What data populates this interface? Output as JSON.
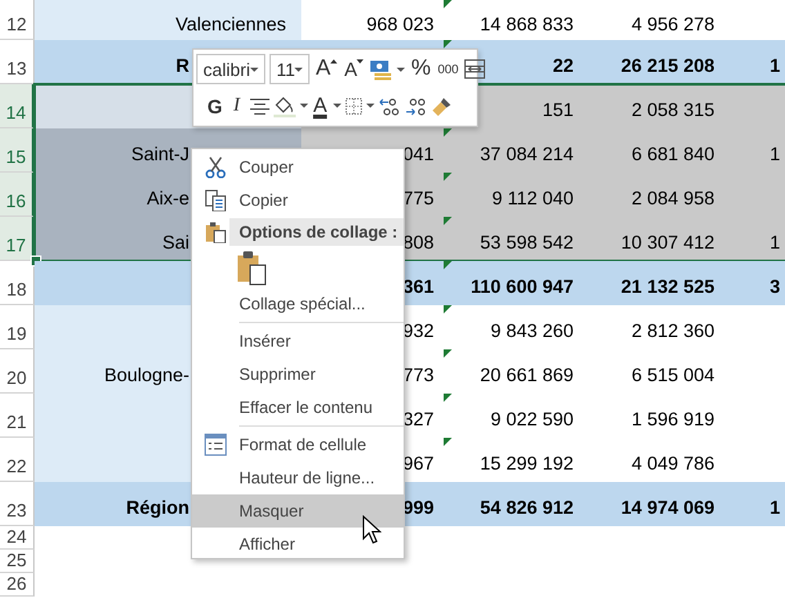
{
  "sheet": {
    "rows": [
      {
        "number": "12",
        "kind": "city",
        "selected": false,
        "flag": true,
        "cells": {
          "column_1": "Valenciennes",
          "column_2": "968 023",
          "column_3": "14 868 833",
          "column_4": "4 956 278"
        }
      },
      {
        "number": "13",
        "kind": "total",
        "selected": false,
        "flag": true,
        "cells": {
          "column_1": "R",
          "column_3": "22",
          "column_4": "26 215 208",
          "column_5": "1"
        }
      },
      {
        "number": "14",
        "kind": "heading",
        "selected": true,
        "flag": false,
        "cells": {
          "column_3": "151",
          "column_4": "2 058 315"
        }
      },
      {
        "number": "15",
        "kind": "city",
        "selected": true,
        "flag": true,
        "cells": {
          "column_1": "Saint-J",
          "column_2": "041",
          "column_3": "37 084 214",
          "column_4": "6 681 840",
          "column_5": "1"
        }
      },
      {
        "number": "16",
        "kind": "city",
        "selected": true,
        "flag": true,
        "cells": {
          "column_1": "Aix-e",
          "column_2": "775",
          "column_3": "9 112 040",
          "column_4": "2 084 958"
        }
      },
      {
        "number": "17",
        "kind": "city",
        "selected": true,
        "flag": true,
        "cells": {
          "column_1": "Sai",
          "column_2": "808",
          "column_3": "53 598 542",
          "column_4": "10 307 412",
          "column_5": "1"
        }
      },
      {
        "number": "18",
        "kind": "total",
        "selected": false,
        "flag": true,
        "cells": {
          "column_2": "361",
          "column_3": "110 600 947",
          "column_4": "21 132 525",
          "column_5": "3"
        }
      },
      {
        "number": "19",
        "kind": "city",
        "selected": false,
        "flag": true,
        "cells": {
          "column_2": "932",
          "column_3": "9 843 260",
          "column_4": "2 812 360"
        }
      },
      {
        "number": "20",
        "kind": "city",
        "selected": false,
        "flag": true,
        "cells": {
          "column_1": "Boulogne-",
          "column_2": "773",
          "column_3": "20 661 869",
          "column_4": "6 515 004"
        }
      },
      {
        "number": "21",
        "kind": "city",
        "selected": false,
        "flag": true,
        "cells": {
          "column_2": "327",
          "column_3": "9 022 590",
          "column_4": "1 596 919"
        }
      },
      {
        "number": "22",
        "kind": "city",
        "selected": false,
        "flag": true,
        "cells": {
          "column_2": "967",
          "column_3": "15 299 192",
          "column_4": "4 049 786"
        }
      },
      {
        "number": "23",
        "kind": "total",
        "selected": false,
        "flag": false,
        "cells": {
          "column_1": "Région",
          "column_2": "999",
          "column_3": "54 826 912",
          "column_4": "14 974 069",
          "column_5": "1"
        }
      },
      {
        "number": "24",
        "kind": "blank",
        "selected": false,
        "flag": false,
        "cells": {}
      },
      {
        "number": "25",
        "kind": "blank",
        "selected": false,
        "flag": false,
        "cells": {}
      },
      {
        "number": "26",
        "kind": "blank",
        "selected": false,
        "flag": false,
        "cells": {}
      }
    ]
  },
  "mini_toolbar": {
    "font": "calibri",
    "size": "11",
    "grow": "A",
    "shrink": "A",
    "percent": "%",
    "thousands": "000",
    "bold": "G",
    "italic": "I",
    "font_color": "A"
  },
  "context_menu": {
    "items": [
      {
        "kind": "item",
        "label": "Couper",
        "selected": false
      },
      {
        "kind": "item",
        "label": "Copier",
        "selected": false
      },
      {
        "kind": "header",
        "label": "Options de collage :"
      },
      {
        "kind": "paste-option",
        "selected": false
      },
      {
        "kind": "item",
        "label": "Collage spécial...",
        "selected": false
      },
      {
        "kind": "separator"
      },
      {
        "kind": "item",
        "label": "Insérer",
        "selected": false
      },
      {
        "kind": "item",
        "label": "Supprimer",
        "selected": false
      },
      {
        "kind": "item",
        "label": "Effacer le contenu",
        "selected": false
      },
      {
        "kind": "separator"
      },
      {
        "kind": "item",
        "label": "Format de cellule",
        "selected": false
      },
      {
        "kind": "item",
        "label": "Hauteur de ligne...",
        "selected": false
      },
      {
        "kind": "item",
        "label": "Masquer",
        "selected": true
      },
      {
        "kind": "item",
        "label": "Afficher",
        "selected": false
      }
    ]
  }
}
